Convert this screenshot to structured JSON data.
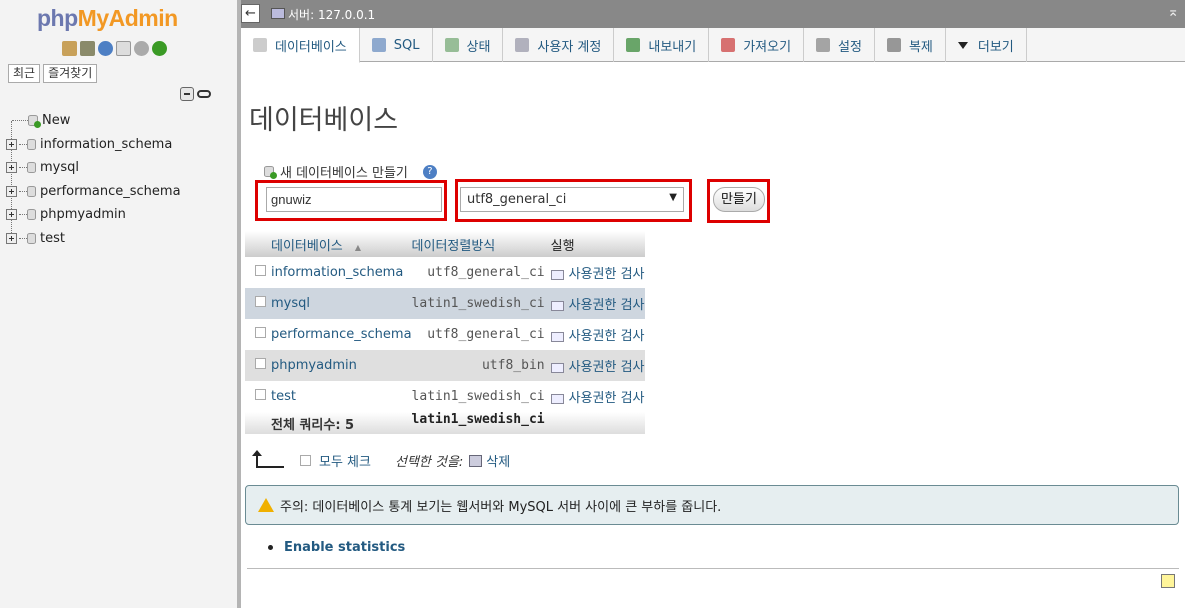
{
  "nav": {
    "logo_php": "php",
    "logo_myadmin": "MyAdmin",
    "recent_label": "최근",
    "favorites_label": "즐겨찾기",
    "tree": [
      {
        "label": "New",
        "type": "new"
      },
      {
        "label": "information_schema",
        "type": "db"
      },
      {
        "label": "mysql",
        "type": "db"
      },
      {
        "label": "performance_schema",
        "type": "db"
      },
      {
        "label": "phpmyadmin",
        "type": "db"
      },
      {
        "label": "test",
        "type": "db"
      }
    ]
  },
  "topbar": {
    "back_arrow": "←",
    "server_label": "서버: 127.0.0.1",
    "collapse": "⌅"
  },
  "menu": [
    {
      "label": "데이터베이스",
      "icon": "database-icon",
      "active": true
    },
    {
      "label": "SQL",
      "icon": "sql-icon"
    },
    {
      "label": "상태",
      "icon": "status-icon"
    },
    {
      "label": "사용자 계정",
      "icon": "users-icon"
    },
    {
      "label": "내보내기",
      "icon": "export-icon"
    },
    {
      "label": "가져오기",
      "icon": "import-icon"
    },
    {
      "label": "설정",
      "icon": "wrench-icon"
    },
    {
      "label": "복제",
      "icon": "replication-icon"
    },
    {
      "label": "더보기",
      "icon": "chevron-down-icon"
    }
  ],
  "main": {
    "title": "데이터베이스",
    "create_legend": "새 데이터베이스 만들기",
    "help_glyph": "?",
    "db_name_value": "gnuwiz",
    "collation_value": "utf8_general_ci",
    "create_button": "만들기",
    "table": {
      "headers": {
        "name": "데이터베이스",
        "sort_arrow": "▲",
        "collation": "데이터정렬방식",
        "action": "실행"
      },
      "rows": [
        {
          "name": "information_schema",
          "collation": "utf8_general_ci",
          "action": "사용권한 검사"
        },
        {
          "name": "mysql",
          "collation": "latin1_swedish_ci",
          "action": "사용권한 검사"
        },
        {
          "name": "performance_schema",
          "collation": "utf8_general_ci",
          "action": "사용권한 검사"
        },
        {
          "name": "phpmyadmin",
          "collation": "utf8_bin",
          "action": "사용권한 검사"
        },
        {
          "name": "test",
          "collation": "latin1_swedish_ci",
          "action": "사용권한 검사"
        }
      ],
      "total_label": "전체 쿼리수: 5",
      "total_collation": "latin1_swedish_ci"
    },
    "check_all": "모두 체크",
    "with_selected": "선택한 것을:",
    "delete": "삭제",
    "notice_text": "주의: 데이터베이스 통계 보기는 웹서버와 MySQL 서버 사이에 큰 부하를 줍니다.",
    "enable_statistics": "Enable statistics"
  },
  "colors": {
    "link": "#235a81",
    "highlight_box": "#dd0000",
    "logo_php": "#6c78af",
    "logo_myadmin": "#f29824"
  }
}
